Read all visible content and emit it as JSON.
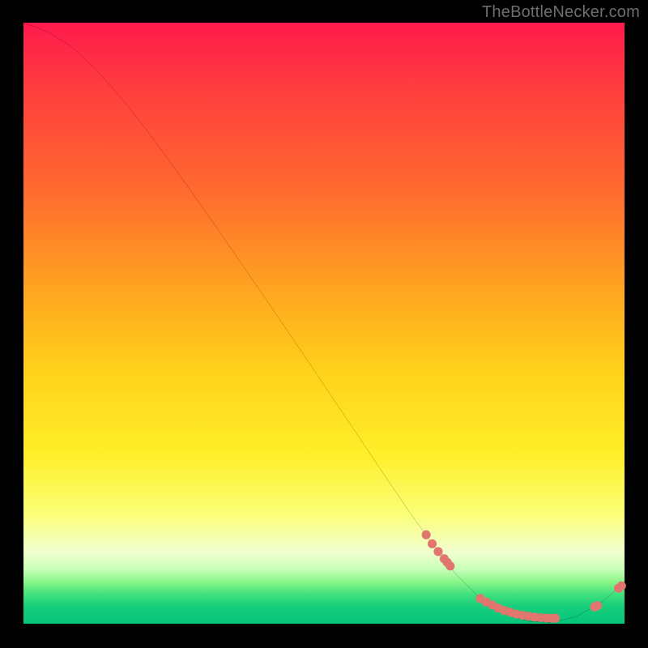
{
  "watermark": "TheBottleNecker.com",
  "chart_data": {
    "type": "line",
    "title": "",
    "xlabel": "",
    "ylabel": "",
    "xlim": [
      0,
      100
    ],
    "ylim": [
      0,
      100
    ],
    "series": [
      {
        "name": "curve",
        "x": [
          0,
          4,
          8,
          12,
          16,
          20,
          24,
          28,
          32,
          36,
          40,
          44,
          48,
          52,
          56,
          60,
          64,
          68,
          72,
          76,
          80,
          84,
          88,
          92,
          96,
          100
        ],
        "y": [
          100,
          98.5,
          96,
          92.3,
          87.8,
          82.8,
          77.4,
          71.8,
          66.1,
          60.3,
          54.5,
          48.6,
          42.7,
          36.7,
          30.8,
          24.8,
          18.9,
          13.3,
          8.2,
          4.2,
          1.6,
          0.4,
          0.2,
          1.2,
          3.4,
          6.8
        ]
      },
      {
        "name": "markers",
        "x": [
          67,
          68,
          69,
          70,
          70.5,
          71,
          76,
          77,
          78,
          79,
          80,
          81,
          82,
          83,
          84,
          85,
          86,
          87,
          88,
          88.5,
          95,
          95.5,
          99,
          99.5
        ],
        "y": [
          14.8,
          13.3,
          12.0,
          10.8,
          10.2,
          9.6,
          4.2,
          3.6,
          3.1,
          2.6,
          2.2,
          1.9,
          1.6,
          1.4,
          1.25,
          1.1,
          1.0,
          0.95,
          0.92,
          0.91,
          2.8,
          3.0,
          5.9,
          6.3
        ]
      }
    ],
    "marker_color": "#e0766e",
    "line_color": "#000000"
  }
}
